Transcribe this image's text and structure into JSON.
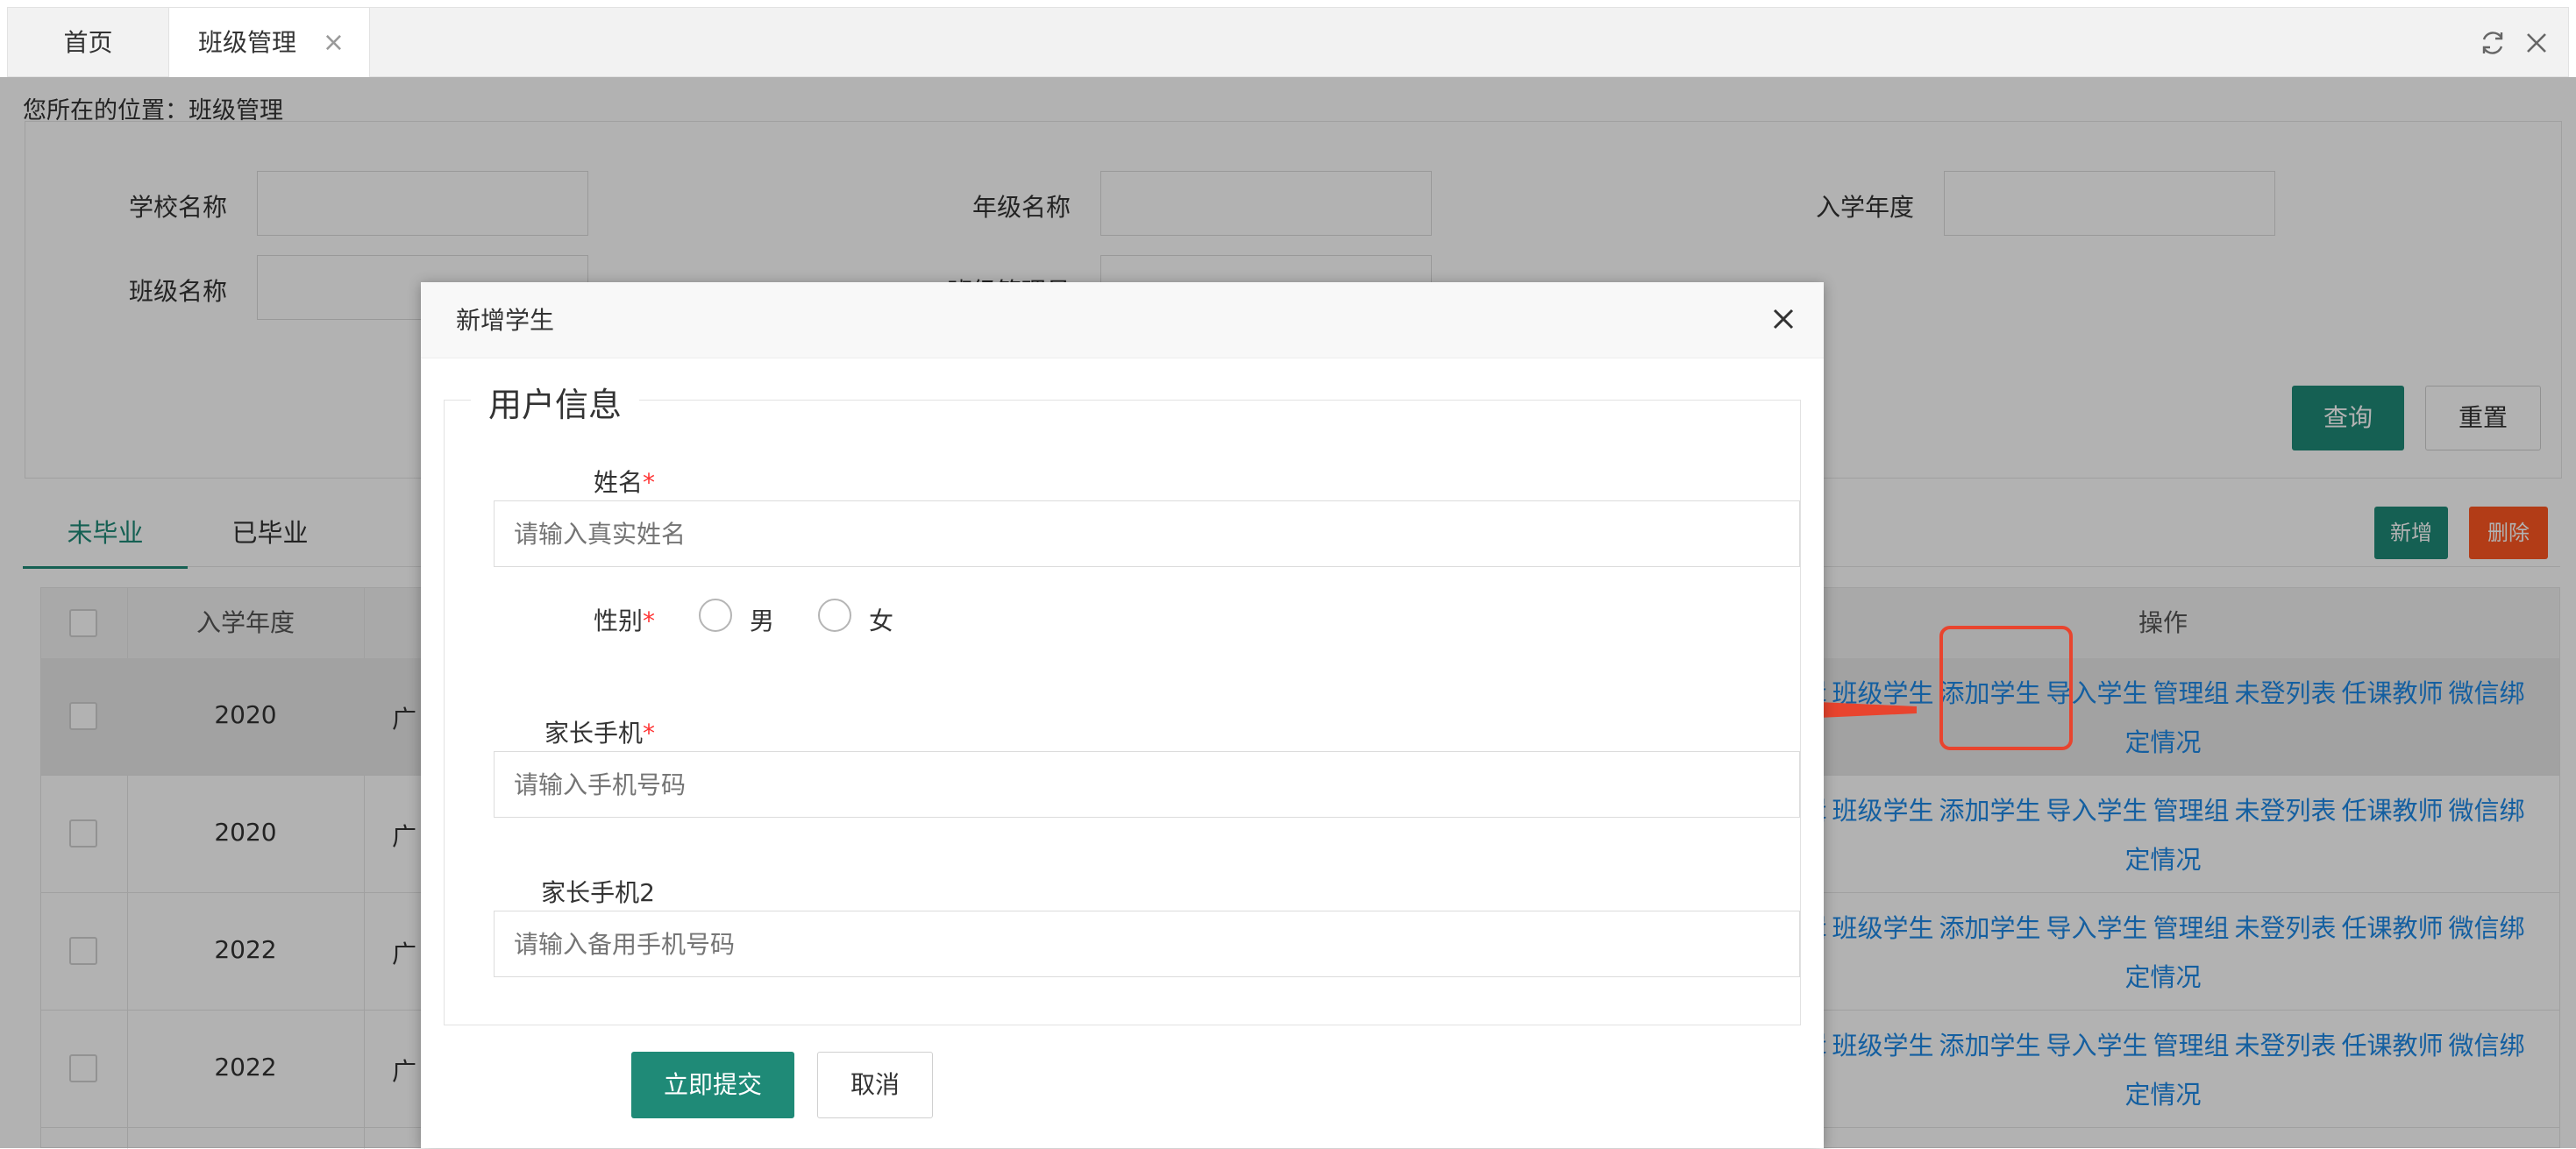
{
  "tabbar": {
    "tabs": [
      {
        "label": "首页"
      },
      {
        "label": "班级管理",
        "close": "×"
      }
    ]
  },
  "breadcrumb": "您所在的位置：班级管理",
  "filters": {
    "school_label": "学校名称",
    "grade_label": "年级名称",
    "year_label": "入学年度",
    "class_label": "班级名称",
    "manager_label": "班级管理员"
  },
  "buttons": {
    "query": "查询",
    "reset": "重置",
    "add": "新增",
    "delete": "删除"
  },
  "status_tabs": [
    "未毕业",
    "已毕业"
  ],
  "table": {
    "headers": {
      "year": "入学年度",
      "ops": "操作"
    },
    "rows": [
      {
        "year": "2020",
        "school": "广"
      },
      {
        "year": "2020",
        "school": "广"
      },
      {
        "year": "2022",
        "school": "广"
      },
      {
        "year": "2022",
        "school": "广"
      }
    ],
    "ops": [
      "辑",
      "班级学生",
      "添加学生",
      "导入学生",
      "管理组",
      "未登列表",
      "任课教师",
      "微信绑"
    ],
    "ops_line2": "定情况"
  },
  "modal": {
    "title": "新增学生",
    "legend": "用户信息",
    "name_label": "姓名",
    "name_placeholder": "请输入真实姓名",
    "gender_label": "性别",
    "gender_options": [
      "男",
      "女"
    ],
    "parent_phone_label": "家长手机",
    "parent_phone_placeholder": "请输入手机号码",
    "parent_phone2_label": "家长手机2",
    "parent_phone2_placeholder": "请输入备用手机号码",
    "required_mark": "*",
    "submit": "立即提交",
    "cancel": "取消"
  },
  "colors": {
    "primary": "#1f8a77",
    "danger": "#ff5722",
    "link": "#1e88e5",
    "annotation": "#e8442e"
  }
}
